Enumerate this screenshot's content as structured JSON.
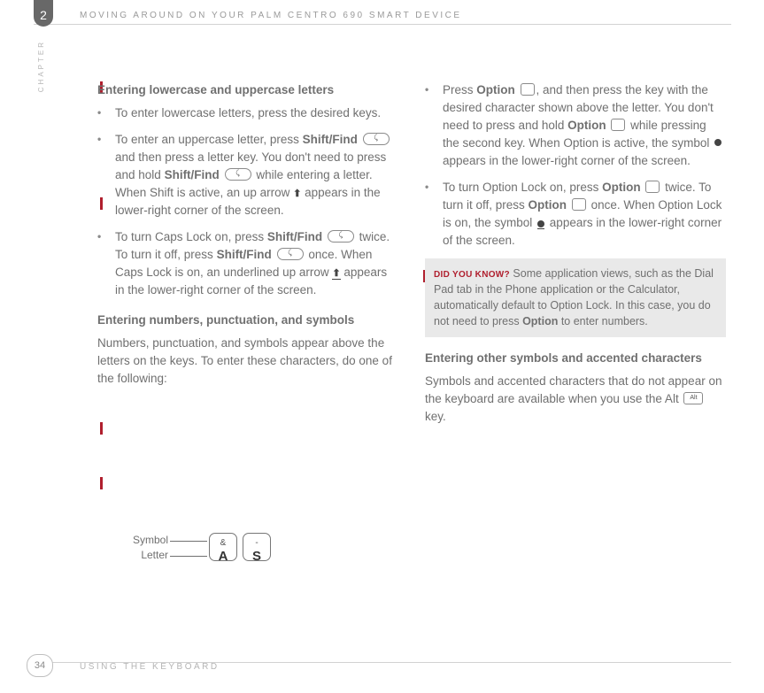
{
  "header": {
    "chapter_number": "2",
    "chapter_label": "CHAPTER",
    "running_title": "MOVING AROUND ON YOUR PALM CENTRO 690 SMART DEVICE"
  },
  "footer": {
    "page_number": "34",
    "running_title": "USING THE KEYBOARD"
  },
  "left": {
    "h1": "Entering lowercase and uppercase letters",
    "b1": "To enter lowercase letters, press the desired keys.",
    "b2a": "To enter an uppercase letter, press ",
    "b2b": "Shift/Find",
    "b2c": " and then press a letter key. You don't need to press and hold ",
    "b2d": "Shift/Find",
    "b2e": " while entering a letter. When Shift is active, an up arrow ",
    "b2f": " appears in the lower-right corner of the screen.",
    "b3a": "To turn Caps Lock on, press ",
    "b3b": "Shift/Find",
    "b3c": " twice. To turn it off, press ",
    "b3d": "Shift/Find",
    "b3e": " once. When Caps Lock is on, an underlined up arrow ",
    "b3f": " appears in the lower-right corner of the screen.",
    "h2": "Entering numbers, punctuation, and symbols",
    "p2": "Numbers, punctuation, and symbols appear above the letters on the keys. To enter these characters, do one of the following:",
    "diag_symbol": "Symbol",
    "diag_letter": "Letter",
    "key_a_upper": "&",
    "key_a_lower": "A",
    "key_s_upper": "-",
    "key_s_lower": "S"
  },
  "right": {
    "b1a": "Press ",
    "b1b": "Option",
    "b1c": ", and then press the key with the desired character shown above the letter. You don't need to press and hold ",
    "b1d": "Option",
    "b1e": " while pressing the second key. When Option is active, the symbol ",
    "b1f": " appears in the lower-right corner of the screen.",
    "b2a": "To turn Option Lock on, press ",
    "b2b": "Option",
    "b2c": " twice. To turn it off, press ",
    "b2d": "Option",
    "b2e": " once. When Option Lock is on, the symbol ",
    "b2f": " appears in the lower-right corner of the screen.",
    "callout_lead": "DID YOU KNOW?",
    "callout_body_a": "Some application views, such as the Dial Pad tab in the Phone application or the Calculator, automatically default to Option Lock. In this case, you do not need to press ",
    "callout_body_b": "Option",
    "callout_body_c": " to enter numbers.",
    "h3": "Entering other symbols and accented characters",
    "p3a": "Symbols and accented characters that do not appear on the keyboard are available when you use the Alt ",
    "p3b": " key.",
    "alt_label": "Alt"
  }
}
